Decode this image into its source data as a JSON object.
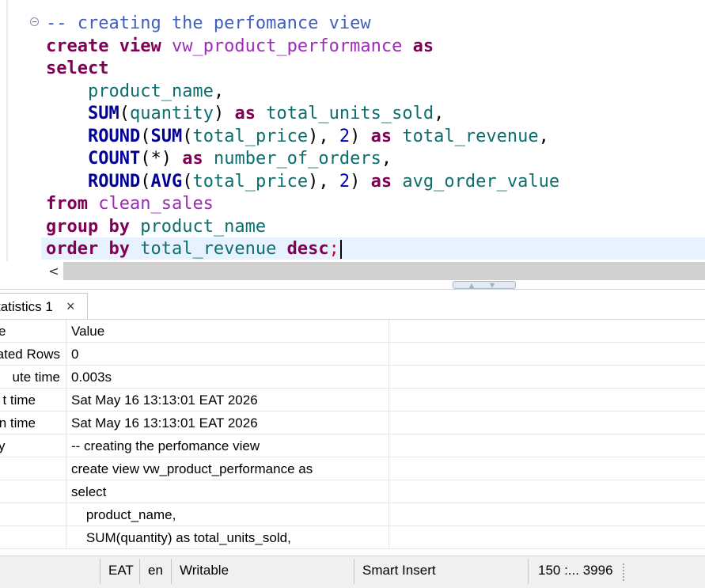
{
  "editor": {
    "lines": [
      {
        "comment": "-- creating the perfomance view"
      },
      {
        "kw1": "create view",
        "name": "vw_product_performance",
        "kw2": "as"
      },
      {
        "kw": "select"
      },
      {
        "col": "product_name",
        "punct": ","
      },
      {
        "fn": "SUM",
        "open": "(",
        "col": "quantity",
        "close": ")",
        "kw": "as",
        "alias": "total_units_sold",
        "punct": ","
      },
      {
        "fn1": "ROUND",
        "open1": "(",
        "fn2": "SUM",
        "open2": "(",
        "col": "total_price",
        "close2": "),",
        "num": "2",
        "close1": ")",
        "kw": "as",
        "alias": "total_revenue",
        "punct": ","
      },
      {
        "fn": "COUNT",
        "args": "(*)",
        "kw": "as",
        "alias": "number_of_orders",
        "punct": ","
      },
      {
        "fn1": "ROUND",
        "open1": "(",
        "fn2": "AVG",
        "open2": "(",
        "col": "total_price",
        "close2": "),",
        "num": "2",
        "close1": ")",
        "kw": "as",
        "alias": "avg_order_value"
      },
      {
        "kw": "from",
        "table": "clean_sales"
      },
      {
        "kw": "group by",
        "col": "product_name"
      },
      {
        "kw1": "order by",
        "col": "total_revenue",
        "kw2": "desc",
        "semi": ";"
      }
    ],
    "scroll_left_arrow": "<"
  },
  "results": {
    "tab_label": "tatistics 1",
    "tab_close": "×",
    "header": {
      "name": "e",
      "value": "Value"
    },
    "rows": [
      {
        "name": "ated Rows",
        "value": "0"
      },
      {
        "name": "ute time",
        "value": "0.003s"
      },
      {
        "name": "t time",
        "value": "Sat May 16 13:13:01 EAT 2026"
      },
      {
        "name": "n time",
        "value": "Sat May 16 13:13:01 EAT 2026"
      },
      {
        "name": "y",
        "value": "-- creating the perfomance view"
      },
      {
        "name": "",
        "value": "create view vw_product_performance as"
      },
      {
        "name": "",
        "value": "select"
      },
      {
        "name": "",
        "value": "    product_name,"
      },
      {
        "name": "",
        "value": "    SUM(quantity) as total_units_sold,"
      }
    ]
  },
  "status_bar": {
    "timezone": "EAT",
    "locale": "en",
    "mode": "Writable",
    "insert_mode": "Smart Insert",
    "position": "150 :... 3996"
  },
  "colors": {
    "keyword": "#7f0055",
    "identifier": "#9e2ab8",
    "column": "#0d6e6e",
    "function": "#000099",
    "number": "#0000c0",
    "comment": "#3f5fbf",
    "current_line": "#e8f2fe"
  },
  "icons": {
    "fold": "collapse-minus-icon",
    "scroll": "chevron-left-icon",
    "sash": "up-down-arrows-icon",
    "close": "close-icon",
    "grip": "drag-grip-icon"
  }
}
